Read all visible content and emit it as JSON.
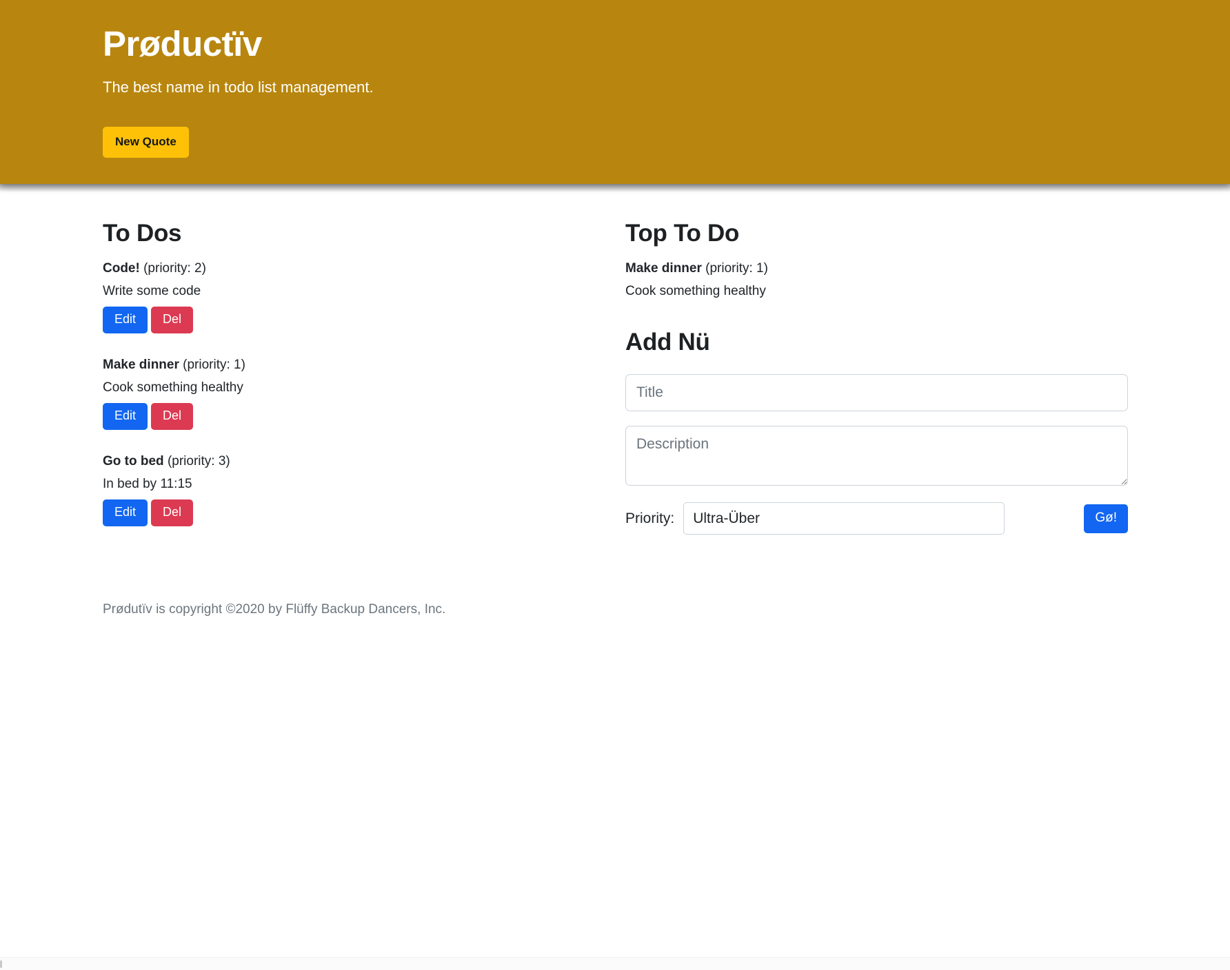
{
  "header": {
    "title": "Prøductïv",
    "tagline": "The best name in todo list management.",
    "new_quote_label": "New Quote",
    "background_color": "#b8860e",
    "button_color": "#ffc107"
  },
  "todos_section": {
    "heading": "To Dos",
    "items": [
      {
        "title": "Code!",
        "priority_text": "(priority: 2)",
        "priority": 2,
        "description": "Write some code",
        "edit_label": "Edit",
        "delete_label": "Del"
      },
      {
        "title": "Make dinner",
        "priority_text": "(priority: 1)",
        "priority": 1,
        "description": "Cook something healthy",
        "edit_label": "Edit",
        "delete_label": "Del"
      },
      {
        "title": "Go to bed",
        "priority_text": "(priority: 3)",
        "priority": 3,
        "description": "In bed by 11:15",
        "edit_label": "Edit",
        "delete_label": "Del"
      }
    ]
  },
  "top_todo_section": {
    "heading": "Top To Do",
    "item": {
      "title": "Make dinner",
      "priority_text": "(priority: 1)",
      "priority": 1,
      "description": "Cook something healthy"
    }
  },
  "add_form": {
    "heading": "Add Nü",
    "title_placeholder": "Title",
    "title_value": "",
    "description_placeholder": "Description",
    "description_value": "",
    "priority_label": "Priority:",
    "priority_selected": "Ultra-Über",
    "priority_options": [
      "Ultra-Über",
      "Ultra-Über"
    ],
    "submit_label": "Gø!",
    "submit_color": "#1266f1"
  },
  "buttons": {
    "edit_color": "#1266f1",
    "delete_color": "#dc3a52"
  },
  "footer": {
    "text": "Prødutïv is copyright ©2020 by Flüffy Backup Dancers, Inc."
  }
}
